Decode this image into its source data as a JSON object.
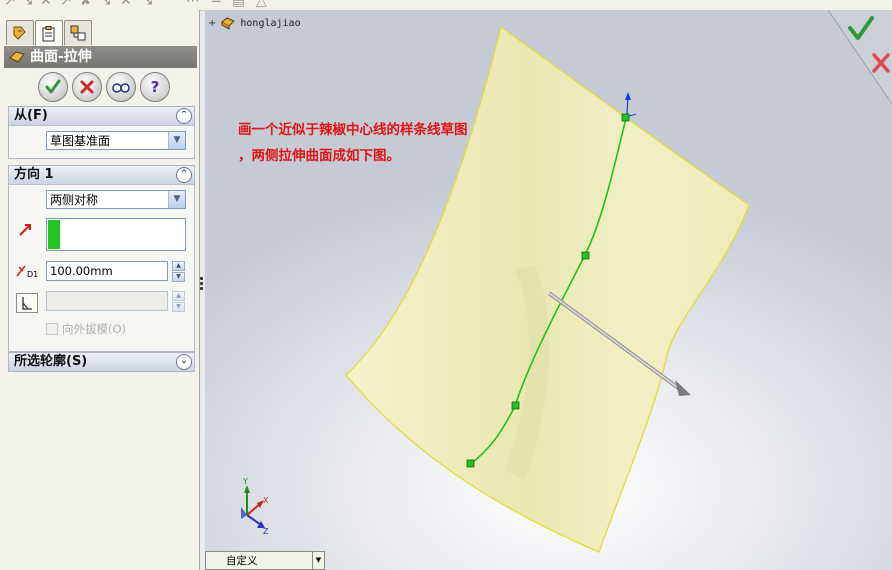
{
  "feature_manager": {
    "tabs": [
      {
        "icon": "feature-tree-icon",
        "active": false
      },
      {
        "icon": "property-manager-icon",
        "active": true
      },
      {
        "icon": "configuration-manager-icon",
        "active": false
      }
    ],
    "title": "曲面-拉伸",
    "actions": {
      "ok": "ok-icon",
      "cancel": "cancel-icon",
      "preview": "preview-icon",
      "help": "help-icon"
    }
  },
  "from_group": {
    "label": "从(F)",
    "start_condition": "草图基准面"
  },
  "direction1_group": {
    "label": "方向 1",
    "end_condition": "两侧对称",
    "depth_value": "100.00mm",
    "depth_symbol": "D1",
    "draft_outward_label": "向外拔模(O)",
    "draft_outward_checked": false
  },
  "selected_contours_group": {
    "label": "所选轮廓(S)"
  },
  "graphics": {
    "tree_root": "honglajiao",
    "annotation_line1": "画一个近似于辣椒中心线的样条线草图",
    "annotation_line2": "，两侧拉伸曲面成如下图。",
    "view_selector": "自定义",
    "triad": {
      "x": "X",
      "y": "Y",
      "z": "Z"
    }
  },
  "colors": {
    "surface_fill": "#f1efbc",
    "surface_edge": "#e0dd3a",
    "spline": "#1ec31e",
    "annotation": "#e01515",
    "confirm_green": "#3aa83a",
    "cancel_red": "#d23a3a"
  }
}
